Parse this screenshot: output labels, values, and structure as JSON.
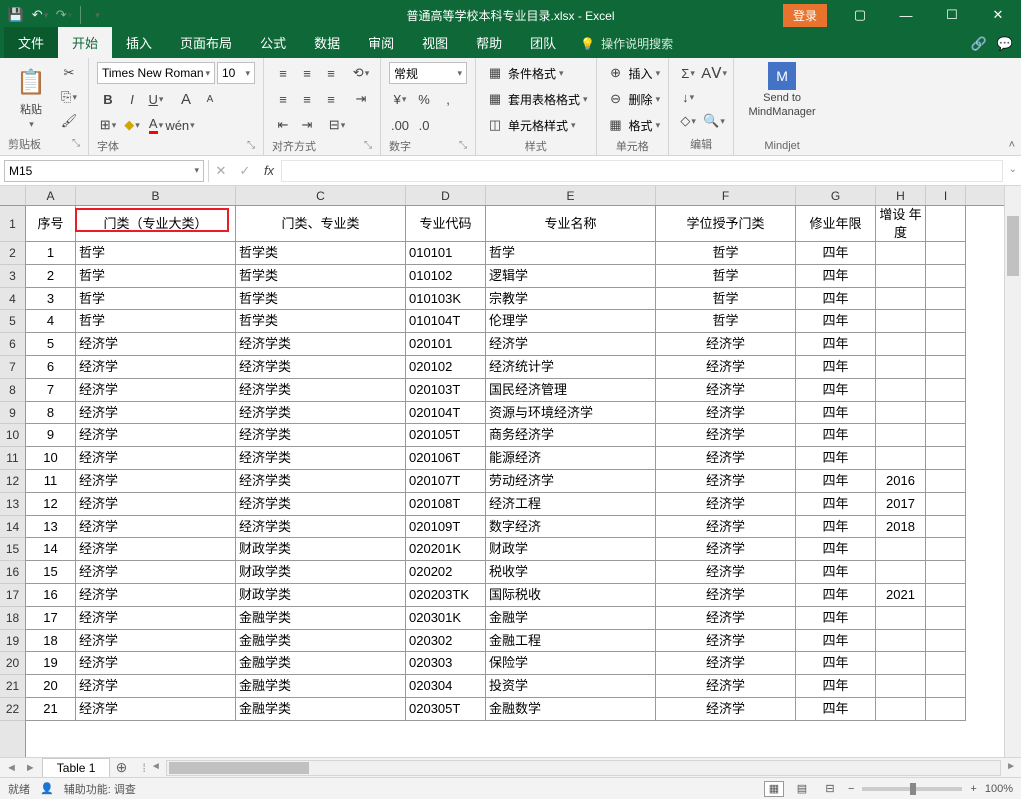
{
  "title": "普通高等学校本科专业目录.xlsx - Excel",
  "login": "登录",
  "tabs": {
    "file": "文件",
    "home": "开始",
    "insert": "插入",
    "layout": "页面布局",
    "formula": "公式",
    "data": "数据",
    "review": "审阅",
    "view": "视图",
    "help": "帮助",
    "team": "团队",
    "tell": "操作说明搜索"
  },
  "ribbon": {
    "clipboard_label": "剪贴板",
    "paste": "粘贴",
    "font_label": "字体",
    "font_name": "Times New Roman",
    "font_size": "10",
    "align_label": "对齐方式",
    "number_label": "数字",
    "number_format": "常规",
    "styles_label": "样式",
    "cond_fmt": "条件格式",
    "tbl_fmt": "套用表格格式",
    "cell_style": "单元格样式",
    "cells_label": "单元格",
    "insert": "插入",
    "delete": "删除",
    "format": "格式",
    "editing_label": "编辑",
    "mindjet_label": "Mindjet",
    "send_to": "Send to",
    "mindmanager": "MindManager"
  },
  "name_box": "M15",
  "columns": [
    "A",
    "B",
    "C",
    "D",
    "E",
    "F",
    "G",
    "H",
    "I"
  ],
  "headers": {
    "A": "序号",
    "B": "门类（专业大类）",
    "C": "门类、专业类",
    "D": "专业代码",
    "E": "专业名称",
    "F": "学位授予门类",
    "G": "修业年限",
    "H": "增设\n年度"
  },
  "rows": [
    {
      "n": "1",
      "b": "哲学",
      "c": "哲学类",
      "d": "010101",
      "e": "哲学",
      "f": "哲学",
      "g": "四年",
      "h": ""
    },
    {
      "n": "2",
      "b": "哲学",
      "c": "哲学类",
      "d": "010102",
      "e": "逻辑学",
      "f": "哲学",
      "g": "四年",
      "h": ""
    },
    {
      "n": "3",
      "b": "哲学",
      "c": "哲学类",
      "d": "010103K",
      "e": "宗教学",
      "f": "哲学",
      "g": "四年",
      "h": ""
    },
    {
      "n": "4",
      "b": "哲学",
      "c": "哲学类",
      "d": "010104T",
      "e": "伦理学",
      "f": "哲学",
      "g": "四年",
      "h": ""
    },
    {
      "n": "5",
      "b": "经济学",
      "c": "经济学类",
      "d": "020101",
      "e": "经济学",
      "f": "经济学",
      "g": "四年",
      "h": ""
    },
    {
      "n": "6",
      "b": "经济学",
      "c": "经济学类",
      "d": "020102",
      "e": "经济统计学",
      "f": "经济学",
      "g": "四年",
      "h": ""
    },
    {
      "n": "7",
      "b": "经济学",
      "c": "经济学类",
      "d": "020103T",
      "e": "国民经济管理",
      "f": "经济学",
      "g": "四年",
      "h": ""
    },
    {
      "n": "8",
      "b": "经济学",
      "c": "经济学类",
      "d": "020104T",
      "e": "资源与环境经济学",
      "f": "经济学",
      "g": "四年",
      "h": ""
    },
    {
      "n": "9",
      "b": "经济学",
      "c": "经济学类",
      "d": "020105T",
      "e": "商务经济学",
      "f": "经济学",
      "g": "四年",
      "h": ""
    },
    {
      "n": "10",
      "b": "经济学",
      "c": "经济学类",
      "d": "020106T",
      "e": "能源经济",
      "f": "经济学",
      "g": "四年",
      "h": ""
    },
    {
      "n": "11",
      "b": "经济学",
      "c": "经济学类",
      "d": "020107T",
      "e": "劳动经济学",
      "f": "经济学",
      "g": "四年",
      "h": "2016"
    },
    {
      "n": "12",
      "b": "经济学",
      "c": "经济学类",
      "d": "020108T",
      "e": "经济工程",
      "f": "经济学",
      "g": "四年",
      "h": "2017"
    },
    {
      "n": "13",
      "b": "经济学",
      "c": "经济学类",
      "d": "020109T",
      "e": "数字经济",
      "f": "经济学",
      "g": "四年",
      "h": "2018"
    },
    {
      "n": "14",
      "b": "经济学",
      "c": "财政学类",
      "d": "020201K",
      "e": "财政学",
      "f": "经济学",
      "g": "四年",
      "h": ""
    },
    {
      "n": "15",
      "b": "经济学",
      "c": "财政学类",
      "d": "020202",
      "e": "税收学",
      "f": "经济学",
      "g": "四年",
      "h": ""
    },
    {
      "n": "16",
      "b": "经济学",
      "c": "财政学类",
      "d": "020203TK",
      "e": "国际税收",
      "f": "经济学",
      "g": "四年",
      "h": "2021"
    },
    {
      "n": "17",
      "b": "经济学",
      "c": "金融学类",
      "d": "020301K",
      "e": "金融学",
      "f": "经济学",
      "g": "四年",
      "h": ""
    },
    {
      "n": "18",
      "b": "经济学",
      "c": "金融学类",
      "d": "020302",
      "e": "金融工程",
      "f": "经济学",
      "g": "四年",
      "h": ""
    },
    {
      "n": "19",
      "b": "经济学",
      "c": "金融学类",
      "d": "020303",
      "e": "保险学",
      "f": "经济学",
      "g": "四年",
      "h": ""
    },
    {
      "n": "20",
      "b": "经济学",
      "c": "金融学类",
      "d": "020304",
      "e": "投资学",
      "f": "经济学",
      "g": "四年",
      "h": ""
    },
    {
      "n": "21",
      "b": "经济学",
      "c": "金融学类",
      "d": "020305T",
      "e": "金融数学",
      "f": "经济学",
      "g": "四年",
      "h": ""
    }
  ],
  "sheet_tab": "Table 1",
  "status": {
    "ready": "就绪",
    "acc": "辅助功能: 调查",
    "zoom": "100%"
  }
}
